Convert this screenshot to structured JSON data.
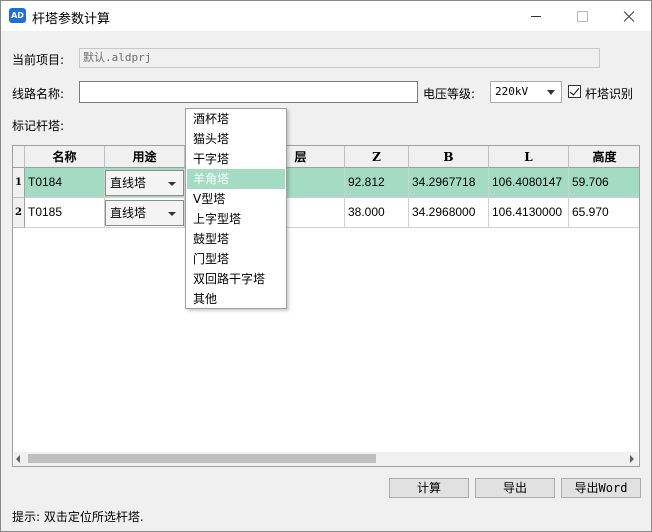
{
  "window": {
    "title": "杆塔参数计算"
  },
  "project": {
    "label": "当前项目:",
    "value": "默认.aldprj"
  },
  "line": {
    "label": "线路名称:",
    "value": ""
  },
  "voltage": {
    "label": "电压等级:",
    "value": "220kV"
  },
  "tower_recog": {
    "label": "杆塔识别",
    "checked": true
  },
  "mark": {
    "label": "标记杆塔:"
  },
  "table": {
    "headers": [
      "名称",
      "用途",
      "层",
      "Z",
      "B",
      "L",
      "高度"
    ],
    "rows": [
      {
        "index": "1",
        "name": "T0184",
        "usage": "直线塔",
        "z": "92.812",
        "b": "34.2967718",
        "l": "106.4080147",
        "h": "59.706"
      },
      {
        "index": "2",
        "name": "T0185",
        "usage": "直线塔",
        "z": "38.000",
        "b": "34.2968000",
        "l": "106.4130000",
        "h": "65.970"
      }
    ]
  },
  "dropdown": {
    "items": [
      "酒杯塔",
      "猫头塔",
      "干字塔",
      "羊角塔",
      "V型塔",
      "上字型塔",
      "鼓型塔",
      "门型塔",
      "双回路干字塔",
      "其他"
    ],
    "highlighted": "羊角塔"
  },
  "buttons": {
    "calc": "计算",
    "export": "导出",
    "export_word": "导出Word"
  },
  "hint": "提示: 双击定位所选杆塔.",
  "colors": {
    "selection": "#a3dcc2"
  }
}
